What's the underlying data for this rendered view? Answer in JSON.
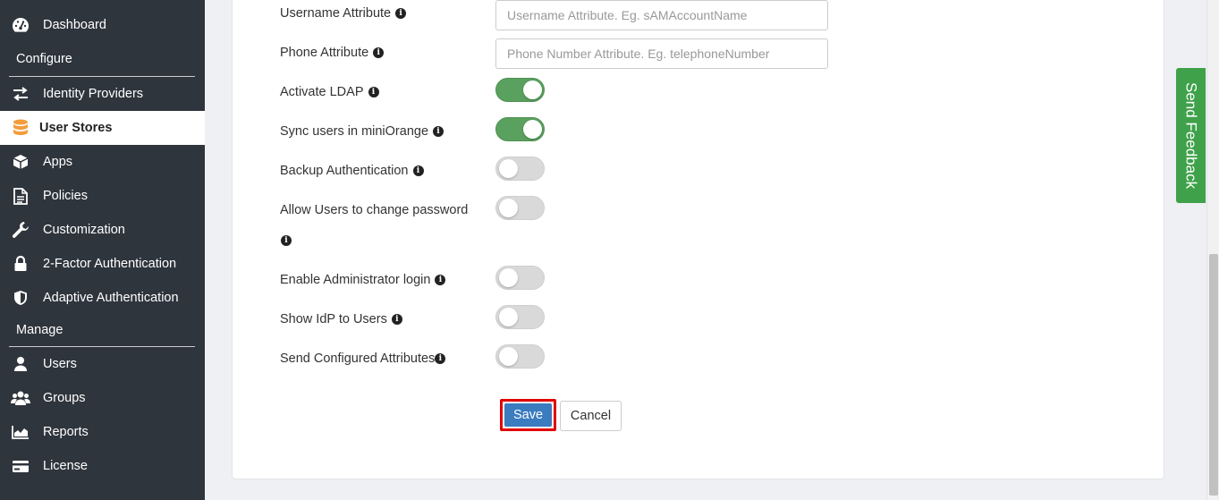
{
  "sidebar": {
    "items": [
      {
        "label": "Dashboard",
        "icon": "dashboard-icon"
      },
      {
        "label": "Identity Providers",
        "icon": "swap-arrows-icon"
      },
      {
        "label": "User Stores",
        "icon": "database-icon"
      },
      {
        "label": "Apps",
        "icon": "cube-icon"
      },
      {
        "label": "Policies",
        "icon": "document-icon"
      },
      {
        "label": "Customization",
        "icon": "wrench-icon"
      },
      {
        "label": "2-Factor Authentication",
        "icon": "lock-icon"
      },
      {
        "label": "Adaptive Authentication",
        "icon": "shield-icon"
      },
      {
        "label": "Users",
        "icon": "user-icon"
      },
      {
        "label": "Groups",
        "icon": "users-icon"
      },
      {
        "label": "Reports",
        "icon": "area-chart-icon"
      },
      {
        "label": "License",
        "icon": "credit-card-icon"
      }
    ],
    "sections": {
      "configure": "Configure",
      "manage": "Manage"
    },
    "active_item": "User Stores",
    "colors": {
      "background": "#2f353d",
      "active_icon": "#f39c3b"
    }
  },
  "form": {
    "username_attr": {
      "label": "Username Attribute",
      "placeholder": "Username Attribute. Eg. sAMAccountName"
    },
    "phone_attr": {
      "label": "Phone Attribute",
      "placeholder": "Phone Number Attribute. Eg. telephoneNumber"
    },
    "toggles": [
      {
        "label": "Activate LDAP",
        "state": "on"
      },
      {
        "label": "Sync users in miniOrange",
        "state": "on"
      },
      {
        "label": "Backup Authentication",
        "state": "off"
      },
      {
        "label": "Allow Users to change password",
        "state": "off"
      },
      {
        "label": "Enable Administrator login",
        "state": "off"
      },
      {
        "label": "Show IdP to Users",
        "state": "off"
      },
      {
        "label": "Send Configured Attributes",
        "state": "off"
      }
    ],
    "info_glyph": "i",
    "buttons": {
      "save": "Save",
      "cancel": "Cancel"
    },
    "colors": {
      "toggle_on": "#5aa05e",
      "save": "#3a7cbf",
      "highlight": "#e00000"
    }
  },
  "feedback": {
    "label": "Send Feedback",
    "color": "#3fa14a"
  }
}
